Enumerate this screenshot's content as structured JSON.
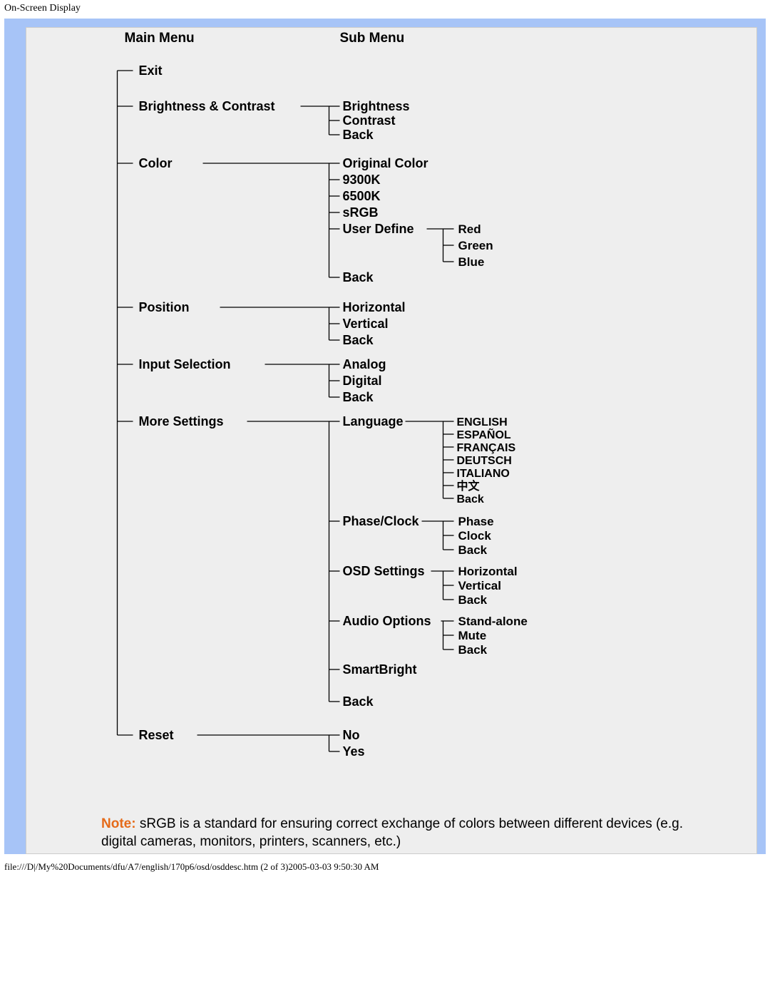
{
  "header": "On-Screen Display",
  "columns": {
    "main": "Main Menu",
    "sub": "Sub Menu"
  },
  "main_items": {
    "exit": "Exit",
    "brightness_contrast": "Brightness & Contrast",
    "color": "Color",
    "position": "Position",
    "input_selection": "Input Selection",
    "more_settings": "More Settings",
    "reset": "Reset"
  },
  "sub": {
    "brightness_contrast": {
      "brightness": "Brightness",
      "contrast": "Contrast",
      "back": "Back"
    },
    "color": {
      "original": "Original Color",
      "k9300": "9300K",
      "k6500": "6500K",
      "srgb": "sRGB",
      "user_define": "User Define",
      "back": "Back"
    },
    "user_define": {
      "red": "Red",
      "green": "Green",
      "blue": "Blue"
    },
    "position": {
      "horizontal": "Horizontal",
      "vertical": "Vertical",
      "back": "Back"
    },
    "input": {
      "analog": "Analog",
      "digital": "Digital",
      "back": "Back"
    },
    "more": {
      "language": "Language",
      "phase_clock": "Phase/Clock",
      "osd_settings": "OSD Settings",
      "audio_options": "Audio Options",
      "smartbright": "SmartBright",
      "back": "Back"
    },
    "language": {
      "english": "ENGLISH",
      "espanol": "ESPAÑOL",
      "francais": "FRANÇAIS",
      "deutsch": "DEUTSCH",
      "italiano": "ITALIANO",
      "chinese": "中文",
      "back": "Back"
    },
    "phase_clock": {
      "phase": "Phase",
      "clock": "Clock",
      "back": "Back"
    },
    "osd_settings": {
      "horizontal": "Horizontal",
      "vertical": "Vertical",
      "back": "Back"
    },
    "audio": {
      "standalone": "Stand-alone",
      "mute": "Mute",
      "back": "Back"
    },
    "reset": {
      "no": "No",
      "yes": "Yes"
    }
  },
  "note": {
    "label": "Note:",
    "text": " sRGB is a standard for ensuring correct exchange of colors between different devices (e.g. digital cameras, monitors, printers, scanners, etc.)"
  },
  "footer": "file:///D|/My%20Documents/dfu/A7/english/170p6/osd/osddesc.htm (2 of 3)2005-03-03 9:50:30 AM"
}
